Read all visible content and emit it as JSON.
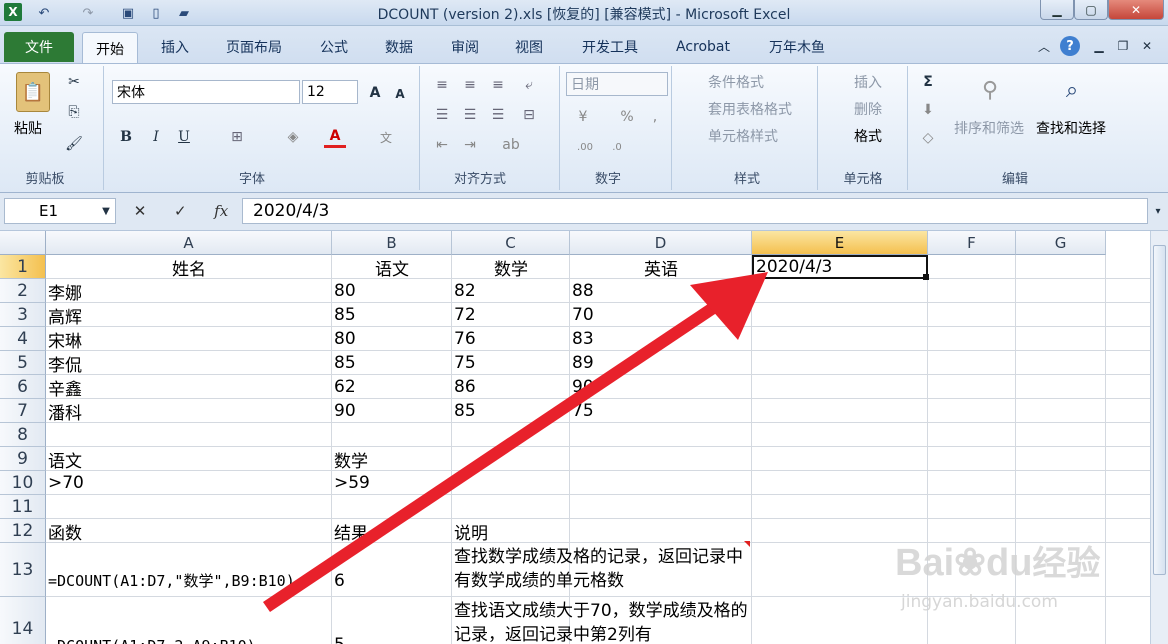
{
  "window": {
    "title": "DCOUNT (version 2).xls  [恢复的]  [兼容模式]  -  Microsoft Excel"
  },
  "tabs": {
    "file": "文件",
    "home": "开始",
    "insert": "插入",
    "layout": "页面布局",
    "formulas": "公式",
    "data": "数据",
    "review": "审阅",
    "view": "视图",
    "developer": "开发工具",
    "acrobat": "Acrobat",
    "wannianmuyu": "万年木鱼"
  },
  "ribbon": {
    "clipboard": {
      "label": "剪贴板",
      "paste": "粘贴"
    },
    "font": {
      "label": "字体",
      "name": "宋体",
      "size": "12"
    },
    "alignment": {
      "label": "对齐方式"
    },
    "number": {
      "label": "数字",
      "format": "日期"
    },
    "styles": {
      "label": "样式",
      "conditional": "条件格式",
      "table": "套用表格格式",
      "cell": "单元格样式"
    },
    "cells": {
      "label": "单元格",
      "insert": "插入",
      "delete": "删除",
      "format": "格式"
    },
    "editing": {
      "label": "编辑",
      "sort": "排序和筛选",
      "find": "查找和选择"
    }
  },
  "formula_bar": {
    "name_box": "E1",
    "value": "2020/4/3"
  },
  "grid": {
    "columns": [
      "A",
      "B",
      "C",
      "D",
      "E",
      "F",
      "G"
    ],
    "rows": [
      "1",
      "2",
      "3",
      "4",
      "5",
      "6",
      "7",
      "8",
      "9",
      "10",
      "11",
      "12",
      "13",
      "14"
    ],
    "cells": {
      "A1": "姓名",
      "B1": "语文",
      "C1": "数学",
      "D1": "英语",
      "E1": "2020/4/3",
      "A2": "李娜",
      "B2": "80",
      "C2": "82",
      "D2": "88",
      "A3": "高辉",
      "B3": "85",
      "C3": "72",
      "D3": "70",
      "A4": "宋琳",
      "B4": "80",
      "C4": "76",
      "D4": "83",
      "A5": "李侃",
      "B5": "85",
      "C5": "75",
      "D5": "89",
      "A6": "辛鑫",
      "B6": "62",
      "C6": "86",
      "D6": "90",
      "A7": "潘科",
      "B7": "90",
      "C7": "85",
      "D7": "75",
      "A9": "语文",
      "B9": "数学",
      "A10": ">70",
      "B10": ">59",
      "A12": "函数",
      "B12": "结果",
      "C12": "说明",
      "A13": "=DCOUNT(A1:D7,\"数学\",B9:B10)",
      "B13": "6",
      "C13": "查找数学成绩及格的记录，返回记录中有数学成绩的单元格数",
      "A14": "=DCOUNT(A1:D7,2,A9:B10)",
      "B14": "5",
      "C14": "查找语文成绩大于70，数学成绩及格的记录，返回记录中第2列有"
    }
  },
  "watermark": {
    "brand": "Bai",
    "brand2": "du",
    "site": "经验",
    "url": "jingyan.baidu.com"
  },
  "colors": {
    "file_tab": "#2d7a35",
    "selected_header": "#f4c04f",
    "arrow": "#e8212b"
  }
}
